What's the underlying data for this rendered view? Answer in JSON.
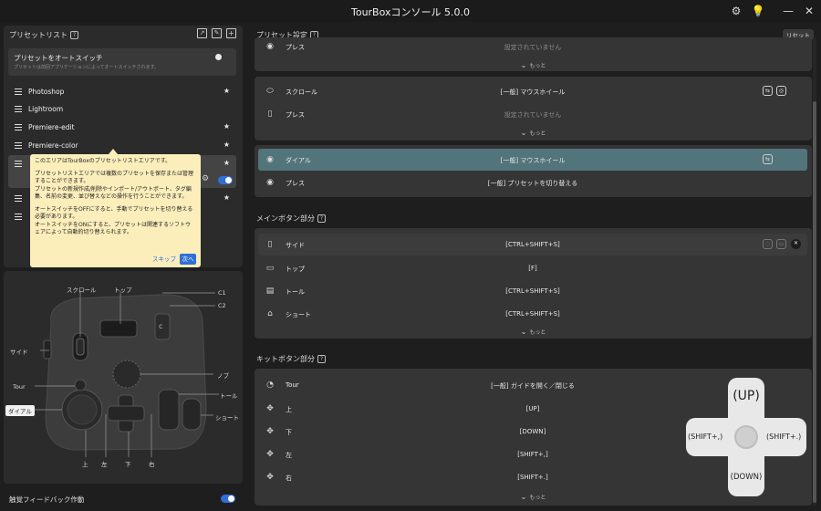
{
  "app": {
    "title": "TourBoxコンソール 5.0.0"
  },
  "left": {
    "preset_list_title": "プリセットリスト",
    "auto_switch_label": "プリセットをオートスイッチ",
    "auto_switch_desc": "プリセットは前回アプリケーションによってオートスイッチされます。",
    "presets": [
      {
        "name": "Photoshop",
        "star": "★"
      },
      {
        "name": "Lightroom",
        "star": ""
      },
      {
        "name": "Premiere-edit",
        "star": "★"
      },
      {
        "name": "Premiere-color",
        "star": "★"
      },
      {
        "name": "",
        "star": "★"
      },
      {
        "name": "",
        "star": ""
      },
      {
        "name": "",
        "star": "★"
      },
      {
        "name": "",
        "star": ""
      }
    ],
    "tooltip": {
      "p1": "このエリアはTourBoxのプリセットリストエリアです。",
      "p2": "プリセットリストエリアでは複数のプリセットを保存または管理することができます。\nプリセットの新規作成/削除やインポート/アウトポート、タグ編集、名前の変更、並び替えなどの操作を行うことができます。",
      "p3": "オートスイッチをOFFにすると、手動でプリセットを切り替える必要があります。\nオートスイッチをONにすると、プリセットは関連するソフトウェアによって自動的切り替えられます。",
      "skip": "スキップ",
      "next": "次へ"
    },
    "device_labels": {
      "scroll": "スクロール",
      "top": "トップ",
      "c1": "C1",
      "c2": "C2",
      "side": "サイド",
      "knob": "ノブ",
      "tour": "Tour",
      "tall": "トール",
      "dial": "ダイアル",
      "short": "ショート",
      "up": "上",
      "left": "左",
      "down": "下",
      "right": "右"
    },
    "haptic_label": "触覚フィードバック作動"
  },
  "right": {
    "preset_settings_title": "プリセット設定",
    "reset_label": "リセット",
    "group1": {
      "press_label": "プレス",
      "press_value": "設定されていません",
      "more": "もっと"
    },
    "group2": {
      "scroll_label": "スクロール",
      "scroll_value": "[一般] マウスホイール",
      "press_label": "プレス",
      "press_value": "設定されていません",
      "more": "もっと"
    },
    "group3": {
      "dial_label": "ダイアル",
      "dial_value": "[一般] マウスホイール",
      "press_label": "プレス",
      "press_value": "[一般] プリセットを切り替える"
    },
    "main_buttons_title": "メインボタン部分",
    "main_buttons": [
      {
        "label": "サイド",
        "value": "[CTRL+SHIFT+S]"
      },
      {
        "label": "トップ",
        "value": "[F]"
      },
      {
        "label": "トール",
        "value": "[CTRL+SHIFT+S]"
      },
      {
        "label": "ショート",
        "value": "[CTRL+SHIFT+S]"
      }
    ],
    "main_more": "もっと",
    "kit_buttons_title": "キットボタン部分",
    "kit_buttons": [
      {
        "label": "Tour",
        "value": "[一般] ガイドを開く／閉じる"
      },
      {
        "label": "上",
        "value": "[UP]"
      },
      {
        "label": "下",
        "value": "[DOWN]"
      },
      {
        "label": "左",
        "value": "[SHIFT+,]"
      },
      {
        "label": "右",
        "value": "[SHIFT+.]"
      }
    ],
    "kit_more": "もっと",
    "dpad": {
      "up": "(UP)",
      "down": "(DOWN)",
      "left": "(SHIFT+,)",
      "right": "(SHIFT+.)"
    }
  },
  "colors": {
    "accent": "#2f6fd6",
    "selected_row": "#52747b",
    "tooltip_bg": "#fbeebb"
  }
}
